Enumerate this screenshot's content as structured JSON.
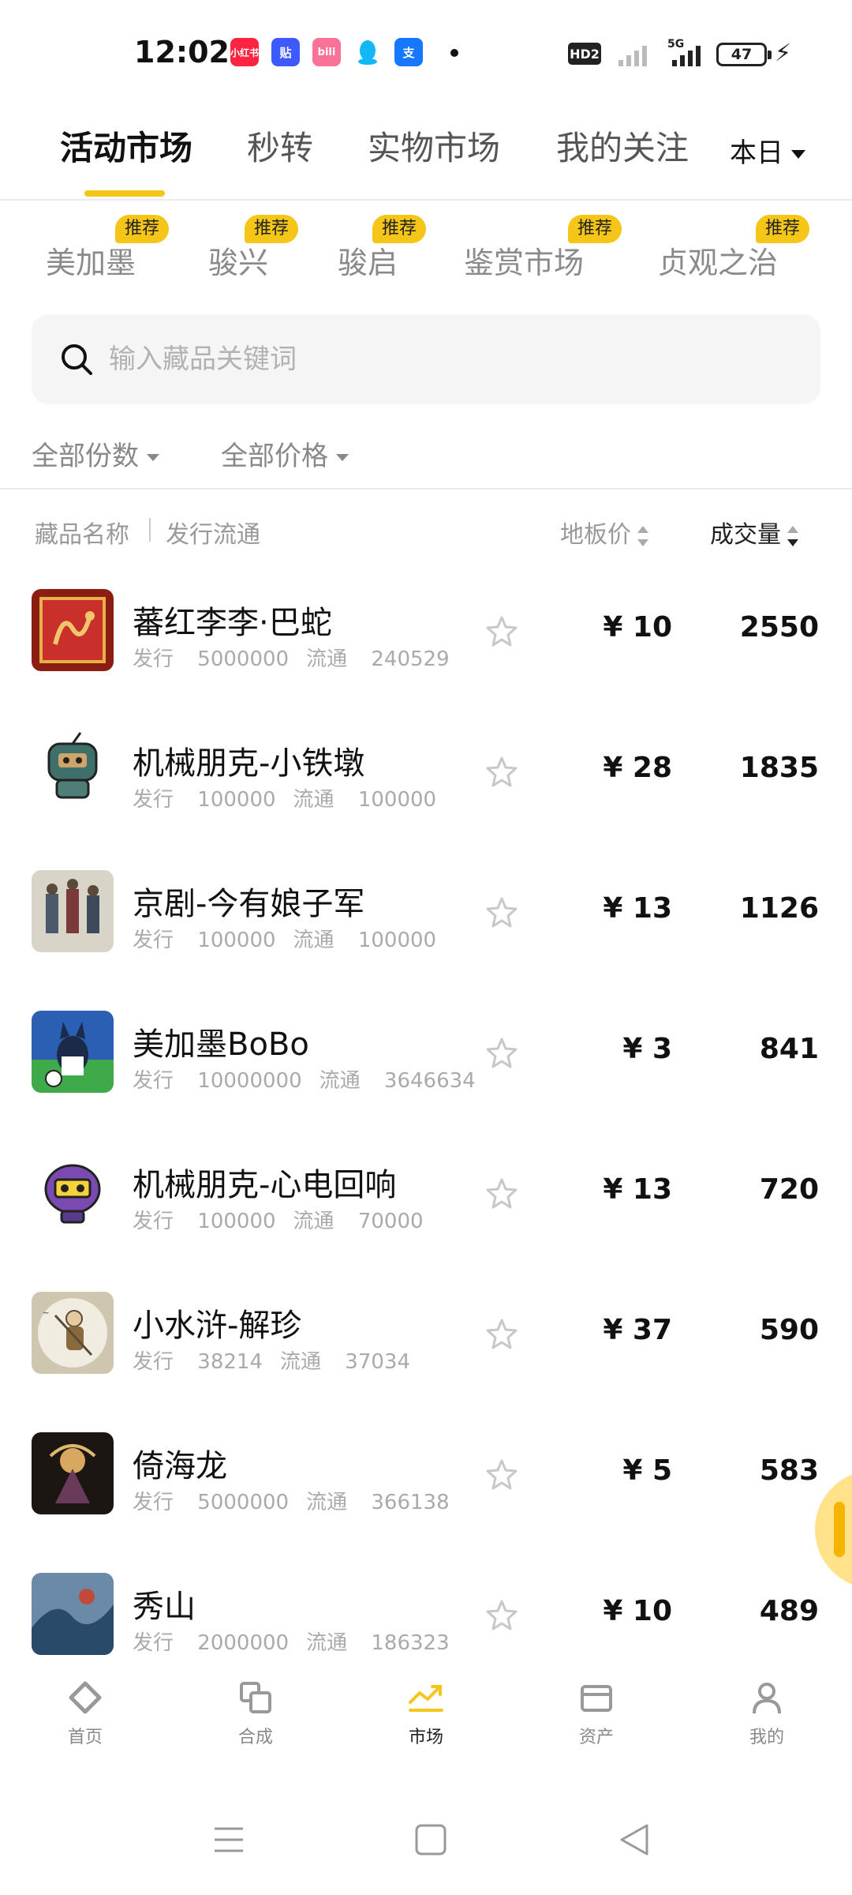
{
  "status_bar": {
    "time": "12:02",
    "app_icons": [
      {
        "name": "xiaohongshu-icon",
        "label": "小红书",
        "color": "#ff2442"
      },
      {
        "name": "tieba-icon",
        "label": "贴",
        "color": "#3d5afe"
      },
      {
        "name": "bilibili-icon",
        "label": "bili",
        "color": "#fb7299"
      },
      {
        "name": "qq-icon",
        "label": "",
        "color": "#12b7f5"
      },
      {
        "name": "alipay-icon",
        "label": "支",
        "color": "#1677ff"
      }
    ],
    "hd": "HD2",
    "network": "5G",
    "battery": "47"
  },
  "top_tabs": [
    {
      "label": "活动市场",
      "active": true
    },
    {
      "label": "秒转",
      "active": false
    },
    {
      "label": "实物市场",
      "active": false
    },
    {
      "label": "我的关注",
      "active": false
    }
  ],
  "period_select": "本日",
  "sub_tabs": [
    {
      "label": "美加墨",
      "badge": "推荐"
    },
    {
      "label": "骏兴",
      "badge": "推荐"
    },
    {
      "label": "骏启",
      "badge": "推荐"
    },
    {
      "label": "鉴赏市场",
      "badge": "推荐"
    },
    {
      "label": "贞观之治",
      "badge": "推荐"
    }
  ],
  "search": {
    "placeholder": "输入藏品关键词"
  },
  "filters": {
    "quantity": "全部份数",
    "price": "全部价格"
  },
  "columns": {
    "name": "藏品名称",
    "circulation": "发行流通",
    "floor_price": "地板价",
    "volume": "成交量"
  },
  "meta_labels": {
    "issue": "发行",
    "circulation": "流通"
  },
  "items": [
    {
      "name": "蕃红李李·巴蛇",
      "issue": "5000000",
      "circulation": "240529",
      "price": "¥ 10",
      "volume": "2550",
      "thumb": "dragon"
    },
    {
      "name": "机械朋克-小铁墩",
      "issue": "100000",
      "circulation": "100000",
      "price": "¥ 28",
      "volume": "1835",
      "thumb": "robot"
    },
    {
      "name": "京剧-今有娘子军",
      "issue": "100000",
      "circulation": "100000",
      "price": "¥ 13",
      "volume": "1126",
      "thumb": "opera"
    },
    {
      "name": "美加墨BoBo",
      "issue": "10000000",
      "circulation": "3646634",
      "price": "¥ 3",
      "volume": "841",
      "thumb": "bobo"
    },
    {
      "name": "机械朋克-心电回响",
      "issue": "100000",
      "circulation": "70000",
      "price": "¥ 13",
      "volume": "720",
      "thumb": "robot2"
    },
    {
      "name": "小水浒-解珍",
      "issue": "38214",
      "circulation": "37034",
      "price": "¥ 37",
      "volume": "590",
      "thumb": "hunter"
    },
    {
      "name": "倚海龙",
      "issue": "5000000",
      "circulation": "366138",
      "price": "¥ 5",
      "volume": "583",
      "thumb": "dragon2"
    },
    {
      "name": "秀山",
      "issue": "2000000",
      "circulation": "186323",
      "price": "¥ 10",
      "volume": "489",
      "thumb": "mountain"
    }
  ],
  "bottom_nav": [
    {
      "label": "首页",
      "icon": "home-icon",
      "active": false
    },
    {
      "label": "合成",
      "icon": "compose-icon",
      "active": false
    },
    {
      "label": "市场",
      "icon": "market-trend-icon",
      "active": true
    },
    {
      "label": "资产",
      "icon": "wallet-icon",
      "active": false
    },
    {
      "label": "我的",
      "icon": "profile-icon",
      "active": false
    }
  ],
  "accent_color": "#f5c518"
}
